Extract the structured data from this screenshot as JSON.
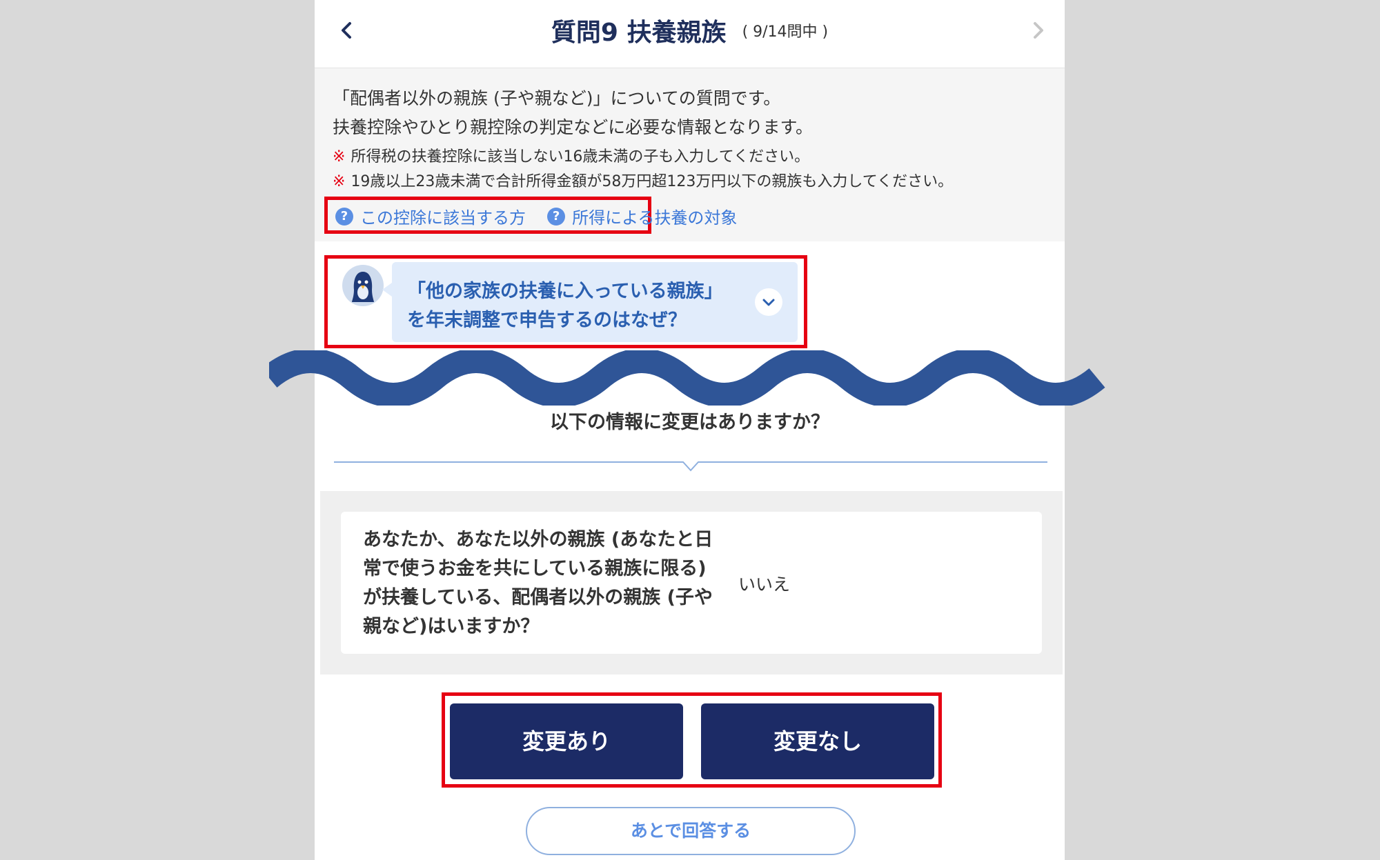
{
  "header": {
    "back_icon": "chevron-left-icon",
    "next_icon": "chevron-right-icon",
    "title": "質問9 扶養親族",
    "progress": "( 9/14問中 )"
  },
  "intro": {
    "line1": "「配偶者以外の親族 (子や親など)」についての質問です。",
    "line2": "扶養控除やひとり親控除の判定などに必要な情報となります。",
    "note_mark": "※",
    "note1": "所得税の扶養控除に該当しない16歳未満の子も入力してください。",
    "note2": "19歳以上23歳未満で合計所得金額が58万円超123万円以下の親族も入力してください。"
  },
  "help_links": [
    {
      "icon": "question-circle-icon",
      "label": "この控除に該当する方"
    },
    {
      "icon": "question-circle-icon",
      "label": "所得による扶養の対象"
    }
  ],
  "faq_bubble": {
    "line1": "「他の家族の扶養に入っている親族」",
    "line2": "を年末調整で申告するのはなぜ？",
    "icon": "chevron-down-icon"
  },
  "question_heading": "以下の情報に変更はありますか？",
  "card": {
    "question": "あなたか、あなた以外の親族 (あなたと日常で使うお金を共にしている親族に限る) が扶養している、配偶者以外の親族 (子や親など)はいますか？",
    "answer": "いいえ"
  },
  "buttons": {
    "changed": "変更あり",
    "unchanged": "変更なし",
    "answer_later": "あとで回答する"
  },
  "colors": {
    "navy": "#1c2b66",
    "link_blue": "#3c78d8",
    "highlight_red": "#e60012",
    "wave_blue": "#2f5597"
  }
}
